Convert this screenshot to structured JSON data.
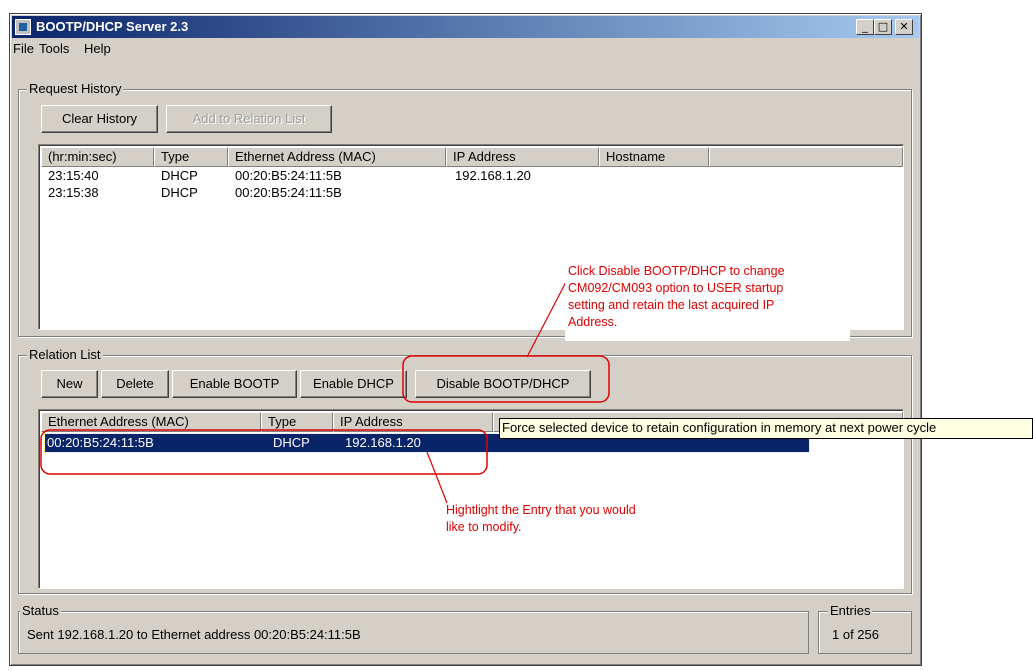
{
  "window": {
    "title": "BOOTP/DHCP Server 2.3",
    "controls": {
      "minimize": "_",
      "maximize": "□",
      "close": "✕"
    }
  },
  "menu": [
    "File",
    "Tools",
    "Help"
  ],
  "request_history": {
    "label": "Request History",
    "buttons": {
      "clear": "Clear History",
      "add": "Add to Relation List"
    },
    "columns": [
      "(hr:min:sec)",
      "Type",
      "Ethernet Address (MAC)",
      "IP Address",
      "Hostname"
    ],
    "rows": [
      {
        "time": "23:15:40",
        "type": "DHCP",
        "mac": "00:20:B5:24:11:5B",
        "ip": "192.168.1.20"
      },
      {
        "time": "23:15:38",
        "type": "DHCP",
        "mac": "00:20:B5:24:11:5B",
        "ip": ""
      }
    ]
  },
  "relation_list": {
    "label": "Relation List",
    "buttons": {
      "new": "New",
      "delete": "Delete",
      "enable_bootp": "Enable BOOTP",
      "enable_dhcp": "Enable DHCP",
      "disable": "Disable BOOTP/DHCP"
    },
    "columns": [
      "Ethernet Address (MAC)",
      "Type",
      "IP Address"
    ],
    "rows": [
      {
        "mac": "00:20:B5:24:11:5B",
        "type": "DHCP",
        "ip": "192.168.1.20"
      }
    ]
  },
  "tooltip": "Force selected device to retain configuration in memory at next power cycle",
  "annotations": {
    "disable_note": [
      "Click Disable BOOTP/DHCP to change",
      "CM092/CM093 option to USER startup",
      "setting and retain the last acquired IP",
      "Address."
    ],
    "highlight_note": [
      "Hightlight the Entry that you would",
      "like to modify."
    ],
    "color": "#e00000"
  },
  "status": {
    "label": "Status",
    "text": "Sent 192.168.1.20 to Ethernet address 00:20:B5:24:11:5B"
  },
  "entries": {
    "label": "Entries",
    "text": "1 of 256"
  },
  "colors": {
    "title_start": "#0a246a",
    "title_end": "#a6caf0",
    "selection": "#0a246a",
    "face": "#d4d0c8",
    "tooltip_bg": "#ffffe1"
  }
}
